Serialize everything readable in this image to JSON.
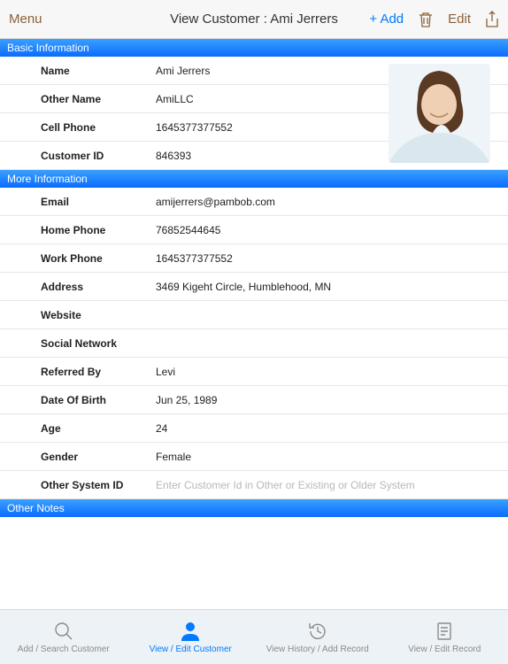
{
  "navbar": {
    "menu": "Menu",
    "title": "View Customer : Ami Jerrers",
    "add": "+ Add",
    "edit": "Edit"
  },
  "sections": {
    "basic": {
      "header": "Basic Information",
      "fields": {
        "name_label": "Name",
        "name_value": "Ami Jerrers",
        "other_name_label": "Other Name",
        "other_name_value": "AmiLLC",
        "cell_phone_label": "Cell Phone",
        "cell_phone_value": "1645377377552",
        "customer_id_label": "Customer ID",
        "customer_id_value": "846393"
      }
    },
    "more": {
      "header": "More Information",
      "fields": {
        "email_label": "Email",
        "email_value": "amijerrers@pambob.com",
        "home_phone_label": "Home Phone",
        "home_phone_value": "76852544645",
        "work_phone_label": "Work Phone",
        "work_phone_value": "1645377377552",
        "address_label": "Address",
        "address_value": "3469 Kigeht Circle, Humblehood, MN",
        "website_label": "Website",
        "website_value": "",
        "social_label": "Social Network",
        "social_value": "",
        "referred_label": "Referred By",
        "referred_value": "Levi",
        "dob_label": "Date Of Birth",
        "dob_value": "Jun 25, 1989",
        "age_label": "Age",
        "age_value": "24",
        "gender_label": "Gender",
        "gender_value": "Female",
        "other_sys_label": "Other System ID",
        "other_sys_placeholder": "Enter Customer Id in Other or Existing or Older System"
      }
    },
    "notes": {
      "header": "Other Notes"
    }
  },
  "tabs": {
    "t1": "Add / Search Customer",
    "t2": "View / Edit Customer",
    "t3": "View History / Add Record",
    "t4": "View / Edit Record"
  }
}
